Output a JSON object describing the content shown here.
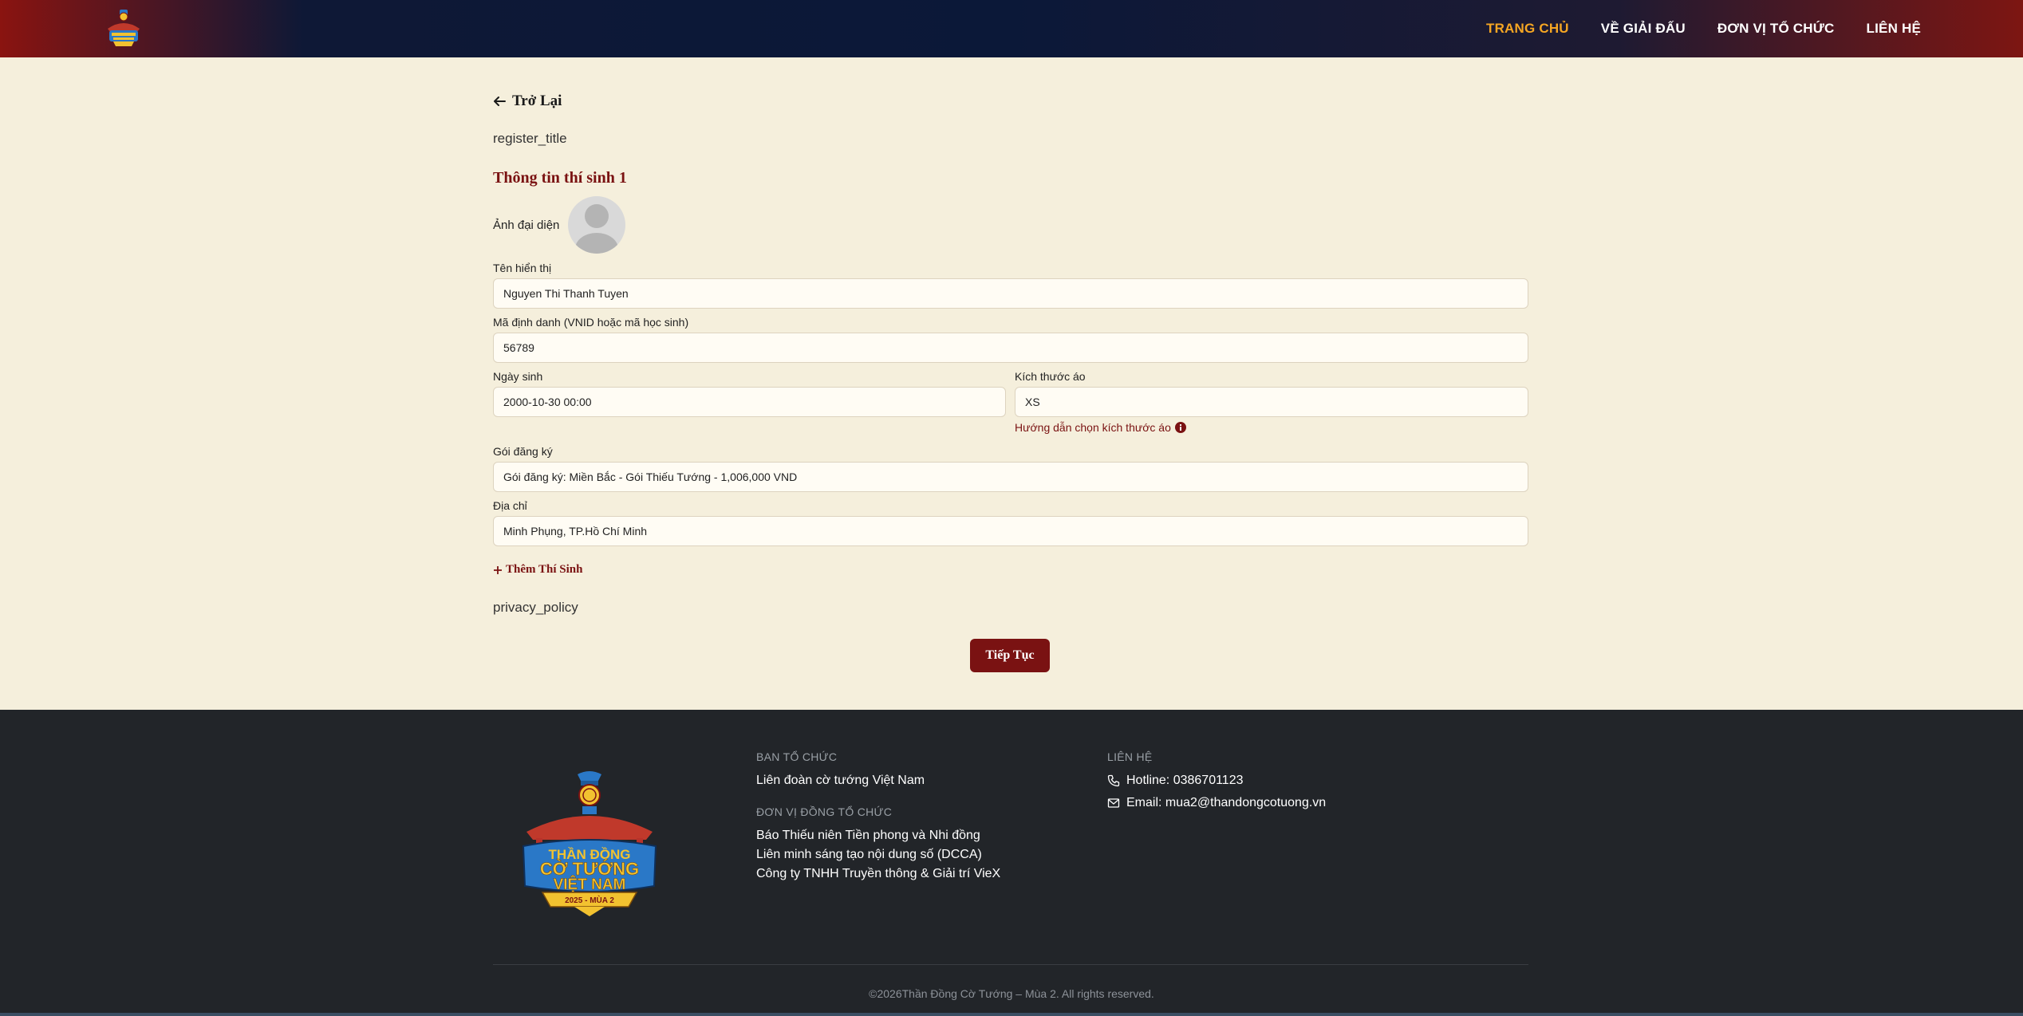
{
  "header": {
    "nav": [
      {
        "label": "TRANG CHỦ",
        "active": true
      },
      {
        "label": "VỀ GIẢI ĐẤU",
        "active": false
      },
      {
        "label": "ĐƠN VỊ TỔ CHỨC",
        "active": false
      },
      {
        "label": "LIÊN HỆ",
        "active": false
      }
    ]
  },
  "form": {
    "back_label": "Trở Lại",
    "register_title": "register_title",
    "section_title": "Thông tin thí sinh 1",
    "avatar_label": "Ảnh đại diện",
    "display_name": {
      "label": "Tên hiển thị",
      "value": "Nguyen Thi Thanh Tuyen"
    },
    "id_code": {
      "label": "Mã định danh (VNID hoặc mã học sinh)",
      "value": "56789"
    },
    "birthdate": {
      "label": "Ngày sinh",
      "value": "2000-10-30 00:00"
    },
    "shirt_size": {
      "label": "Kích thước áo",
      "value": "XS"
    },
    "size_guide": "Hướng dẫn chọn kích thước áo",
    "package": {
      "label": "Gói đăng ký",
      "value": "Gói đăng ký: Miền Bắc - Gói Thiếu Tướng - 1,006,000 VND"
    },
    "address": {
      "label": "Địa chỉ",
      "value": "Minh Phụng, TP.Hồ Chí Minh"
    },
    "add_contestant": "Thêm Thí Sinh",
    "privacy_policy": "privacy_policy",
    "continue_label": "Tiếp Tục"
  },
  "footer": {
    "organizer_heading": "BAN TỔ CHỨC",
    "organizer": "Liên đoàn cờ tướng Việt Nam",
    "co_organizer_heading": "ĐƠN VỊ ĐỒNG TỔ CHỨC",
    "co_organizers": [
      "Báo Thiếu niên Tiền phong và Nhi đồng",
      "Liên minh sáng tạo nội dung số (DCCA)",
      "Công ty TNHH Truyền thông & Giải trí VieX"
    ],
    "contact_heading": "LIÊN HỆ",
    "hotline": "Hotline: 0386701123",
    "email": "Email: mua2@thandongcotuong.vn",
    "copyright": "©2026Thần Đồng Cờ Tướng – Mùa 2. All rights reserved.",
    "logo_text": [
      "THẦN ĐỒNG",
      "CỜ TƯỚNG",
      "VIỆT NAM",
      "2025 - MÙA 2"
    ]
  },
  "colors": {
    "accent": "#7a1212",
    "nav_active": "#f5a623",
    "page_bg": "#f5efdc",
    "footer_bg": "#222529"
  }
}
